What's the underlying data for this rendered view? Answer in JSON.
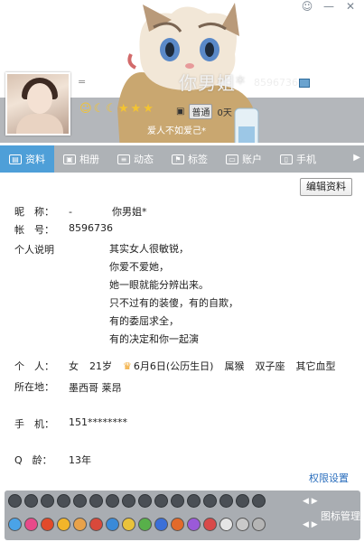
{
  "window": {
    "controls": [
      "☺",
      "—",
      "✕"
    ]
  },
  "profile": {
    "dash": "=",
    "nickname": "你男姐*",
    "uid": "8596736",
    "level_icons": [
      "☺",
      "☾",
      "☾",
      "★",
      "★",
      "★"
    ],
    "status_chip": "▣",
    "status_text": "普通",
    "days": "0天",
    "signature": "爱人不如爱己*"
  },
  "tabs": [
    {
      "label": "资料",
      "icon": "▤"
    },
    {
      "label": "相册",
      "icon": "▣"
    },
    {
      "label": "动态",
      "icon": "≡"
    },
    {
      "label": "标签",
      "icon": "⚑"
    },
    {
      "label": "账户",
      "icon": "▭"
    },
    {
      "label": "手机",
      "icon": "▯"
    }
  ],
  "tab_next": "▶",
  "edit_button": "编辑资料",
  "fields": {
    "nick_label": "昵　称：",
    "nick_value": "-　　　　你男姐*",
    "account_label": "帐　号：",
    "account_value": "8596736",
    "bio_label": "个人说明",
    "bio_lines": [
      "其实女人很敏锐，",
      "你爱不爱她，",
      "她一眼就能分辨出来。",
      "只不过有的装傻，有的自欺，",
      "有的委屈求全，",
      "有的决定和你一起演"
    ],
    "personal_label": "个　人：",
    "gender": "女",
    "age": "21岁",
    "birthday": "6月6日(公历生日)",
    "zodiac": "属猴",
    "star_sign": "双子座",
    "blood": "其它血型",
    "location_label": "所在地：",
    "location_value": "墨西哥 莱昂",
    "phone_label": "手　机：",
    "phone_value": "151********",
    "qage_label": "Q　龄：",
    "qage_value": "13年"
  },
  "permission_link": "权限设置",
  "icon_manage": "图标管理",
  "icon_panel_nav": "◀ ▶",
  "colors": {
    "tab_active": "#4e9fd8",
    "tab_bar": "#aeb2b6",
    "link": "#2a6ebd",
    "panel": "#a9adb2"
  }
}
